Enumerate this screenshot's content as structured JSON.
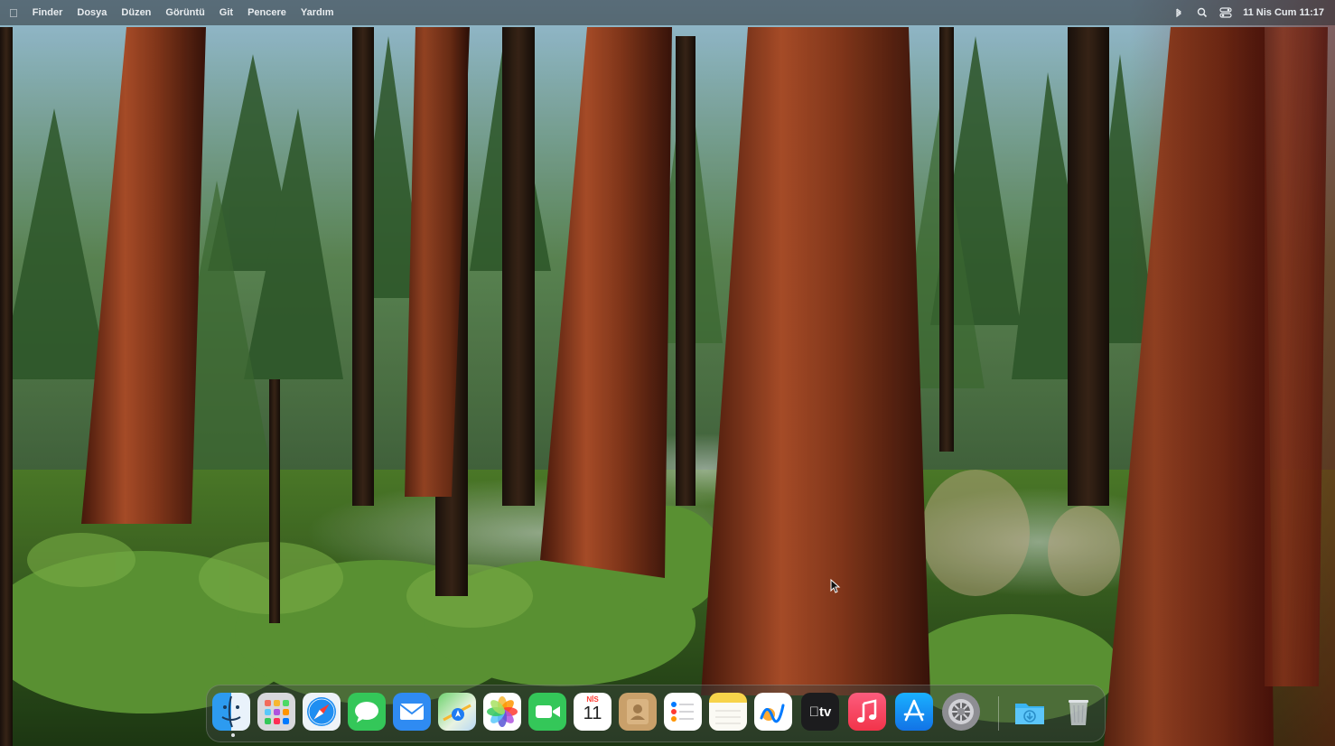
{
  "menubar": {
    "apple_icon": "apple-logo",
    "items": [
      "Finder",
      "Dosya",
      "Düzen",
      "Görüntü",
      "Git",
      "Pencere",
      "Yardım"
    ],
    "status_icons": [
      "bluetooth-icon",
      "search-icon",
      "control-center-icon"
    ],
    "clock": "11 Nis Cum  11:17"
  },
  "dock": {
    "apps": [
      "finder",
      "launchpad",
      "safari",
      "messages",
      "mail",
      "maps",
      "photos",
      "facetime",
      "calendar",
      "contacts",
      "reminders",
      "notes",
      "freeform",
      "tv",
      "music",
      "app-store",
      "system-settings"
    ],
    "running": [
      "finder"
    ],
    "calendar": {
      "month": "NİS",
      "day": "11"
    },
    "tv_label": "tv",
    "others": [
      "downloads-folder",
      "trash"
    ]
  },
  "colors": {
    "menubar": "#2b2f33",
    "dock": "#3c4240"
  }
}
